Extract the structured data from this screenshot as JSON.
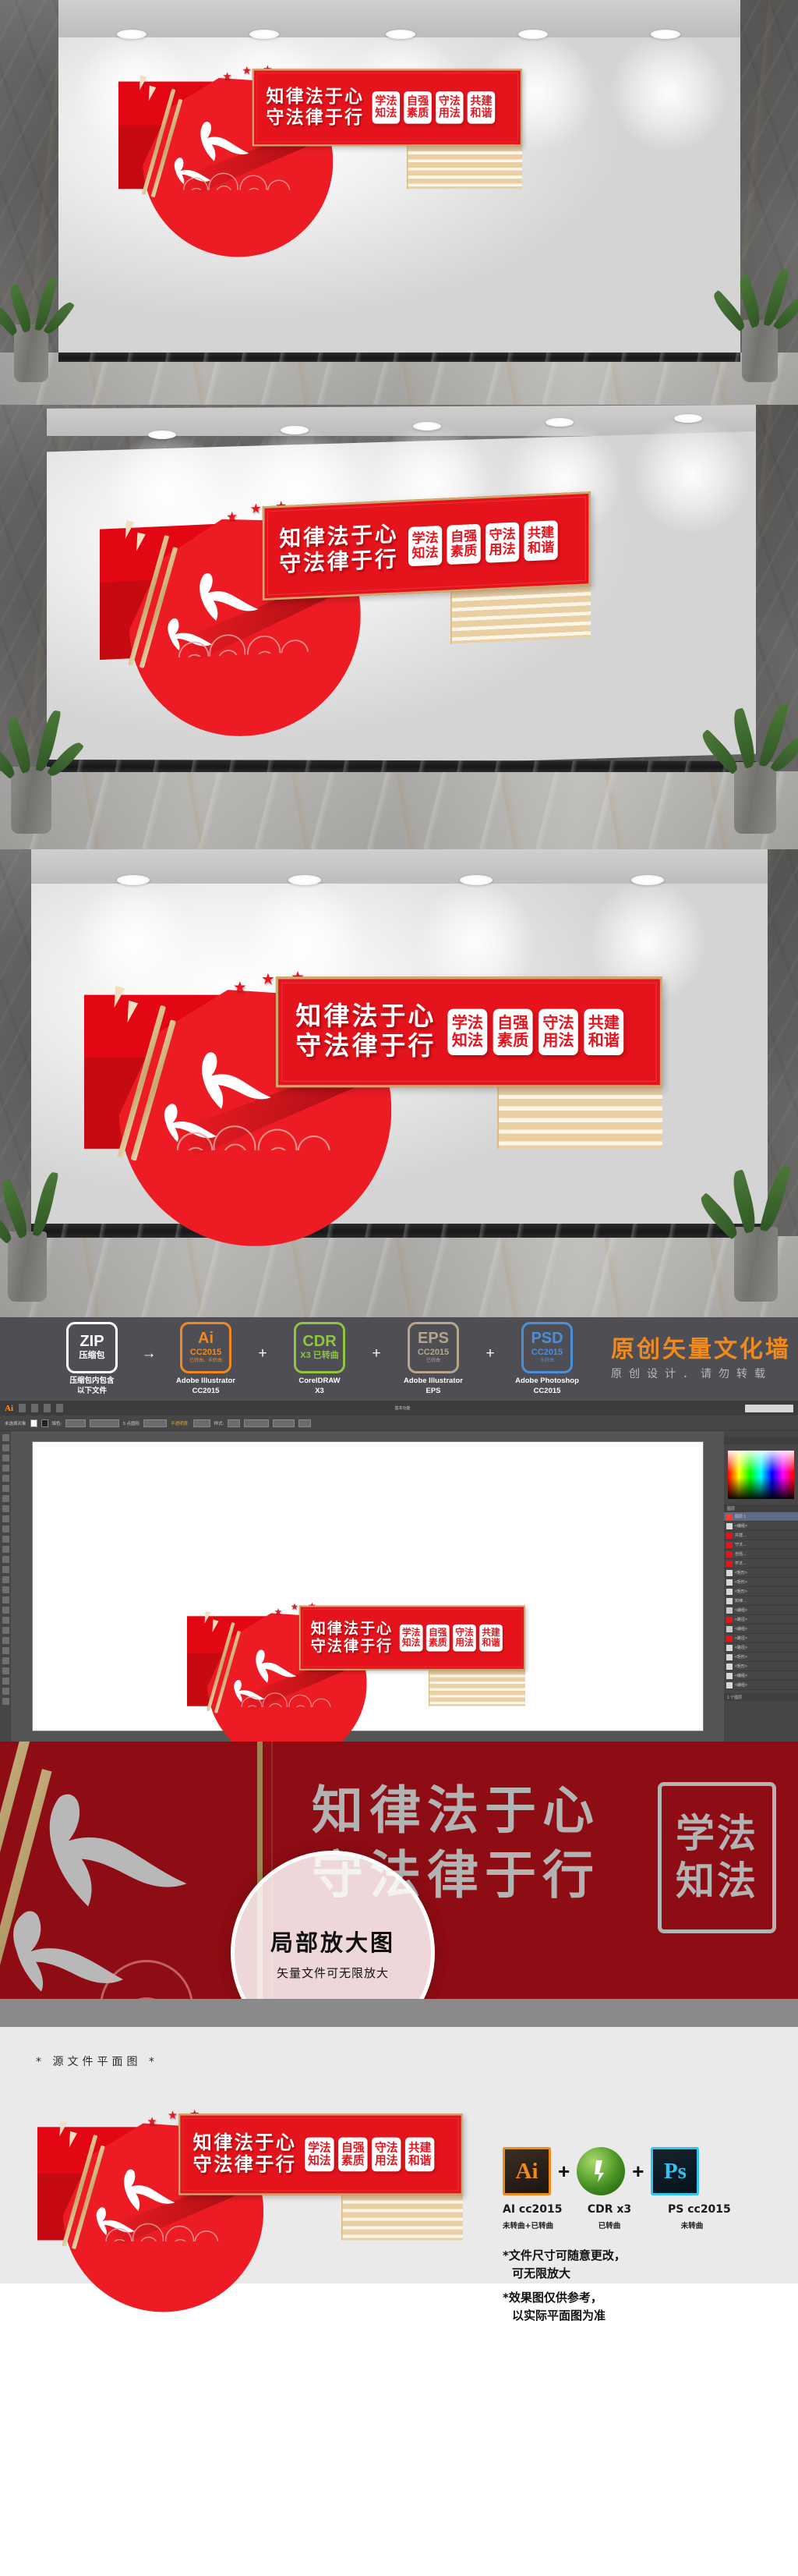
{
  "artwork": {
    "headline_line1": "知律法于心",
    "headline_line2": "守法律于行",
    "chips": [
      {
        "top": "学法",
        "bottom": "知法"
      },
      {
        "top": "自强",
        "bottom": "素质"
      },
      {
        "top": "守法",
        "bottom": "用法"
      },
      {
        "top": "共建",
        "bottom": "和谐"
      }
    ],
    "colors": {
      "red": "#e5131c",
      "deep_red": "#8e0c13",
      "gold": "#cda96b",
      "cream": "#e8cfa4",
      "accent_orange": "#f08a1d"
    }
  },
  "format_strip": {
    "items": [
      {
        "badge": "ZIP",
        "badge_sub": "压缩包",
        "badge_tiny": "",
        "caption_1": "压缩包内包含",
        "caption_2": "以下文件",
        "color": "#ffffff",
        "op_after": "→"
      },
      {
        "badge": "Ai",
        "badge_sub": "CC2015",
        "badge_tiny": "已转曲、未转曲",
        "caption_1": "Adobe Illustrator",
        "caption_2": "CC2015",
        "color": "#f08a1d",
        "op_after": "+"
      },
      {
        "badge": "CDR",
        "badge_sub": "X3 已转曲",
        "badge_tiny": "",
        "caption_1": "CorelDRAW",
        "caption_2": "X3",
        "color": "#8dc63f",
        "op_after": "+"
      },
      {
        "badge": "EPS",
        "badge_sub": "CC2015",
        "badge_tiny": "已转曲",
        "caption_1": "Adobe Illustrator",
        "caption_2": "EPS",
        "color": "#b6a58a",
        "op_after": "+"
      },
      {
        "badge": "PSD",
        "badge_sub": "CC2015",
        "badge_tiny": "未转曲",
        "caption_1": "Adobe Photoshop",
        "caption_2": "CC2015",
        "color": "#4a90d9",
        "op_after": ""
      }
    ],
    "title_main": "原创矢量文化墙",
    "title_sub": "原创设计．请勿转载"
  },
  "illustrator": {
    "app_name": "Ai",
    "control_labels": [
      "未选择对象",
      "填色:",
      "描边:",
      "5 点圆形",
      "不透明度:",
      "100%",
      "样式:",
      "文档设置",
      "首选项"
    ],
    "search_label": "基本功能",
    "layers_panel_title": "图层",
    "layers_count": "1 个图层",
    "layers": [
      {
        "name": "图层 1",
        "selected": true,
        "color": "#ff3b30"
      },
      {
        "name": "<编组>",
        "selected": false,
        "color": "#d8d8d8"
      },
      {
        "name": "共建…",
        "selected": false,
        "color": "#e5131c"
      },
      {
        "name": "守法…",
        "selected": false,
        "color": "#e5131c"
      },
      {
        "name": "自强…",
        "selected": false,
        "color": "#e5131c"
      },
      {
        "name": "学法…",
        "selected": false,
        "color": "#e5131c"
      },
      {
        "name": "<矩形>",
        "selected": false,
        "color": "#d8d8d8"
      },
      {
        "name": "<矩形>",
        "selected": false,
        "color": "#d8d8d8"
      },
      {
        "name": "<矩形>",
        "selected": false,
        "color": "#d8d8d8"
      },
      {
        "name": "知律…",
        "selected": false,
        "color": "#d8d8d8"
      },
      {
        "name": "<编组>",
        "selected": false,
        "color": "#c9c9c9"
      },
      {
        "name": "<路径>",
        "selected": false,
        "color": "#e5131c"
      },
      {
        "name": "<编组>",
        "selected": false,
        "color": "#c9c9c9"
      },
      {
        "name": "<路径>",
        "selected": false,
        "color": "#e5131c"
      },
      {
        "name": "<路径>",
        "selected": false,
        "color": "#d8d8d8"
      },
      {
        "name": "<矩形>",
        "selected": false,
        "color": "#d8d8d8"
      },
      {
        "name": "<矩形>",
        "selected": false,
        "color": "#d8d8d8"
      },
      {
        "name": "<编组>",
        "selected": false,
        "color": "#d8d8d8"
      },
      {
        "name": "<编组>",
        "selected": false,
        "color": "#d8d8d8"
      }
    ]
  },
  "detail_zoom": {
    "circle_title": "局部放大图",
    "circle_sub": "矢量文件可无限放大",
    "bg_text_line1": "知律法于心",
    "bg_text_line2": "守法律于行",
    "chip_top": "学法",
    "chip_bottom": "知法"
  },
  "footer": {
    "label": "* 源文件平面图 *",
    "software": [
      {
        "glyph": "Ai",
        "name": "AI cc2015",
        "note": "未转曲+已转曲"
      },
      {
        "glyph": "CDR",
        "name": "CDR x3",
        "note": "已转曲"
      },
      {
        "glyph": "Ps",
        "name": "PS cc2015",
        "note": "未转曲"
      }
    ],
    "plus_symbol": "+",
    "note_1_line1": "*文件尺寸可随意更改，",
    "note_1_line2": "可无限放大",
    "note_2_line1": "*效果图仅供参考，",
    "note_2_line2": "以实际平面图为准"
  }
}
